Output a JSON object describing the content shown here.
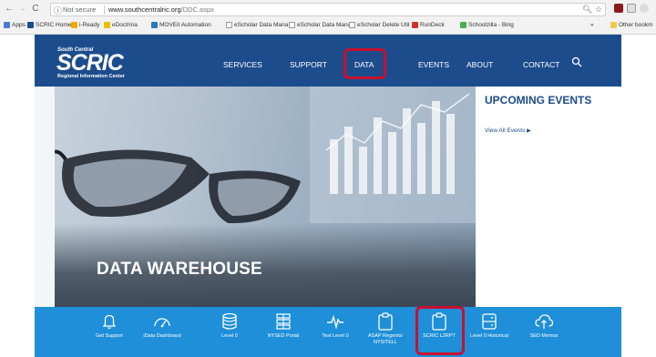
{
  "browser": {
    "url_prefix": "Not secure",
    "url_host": "www.southcentralric.org",
    "url_path": "/DDC.aspx",
    "bookmarks": [
      "Apps",
      "SCRIC Home",
      "i-Ready",
      "eDoctrina",
      "MOVEit Automation",
      "eScholar Data Mana",
      "eScholar Data Mana",
      "eScholar Delete Util",
      "RunDeck",
      "Schoolzilla - Bing",
      "»",
      "Other bookm"
    ]
  },
  "site": {
    "logo_small": "South Central",
    "logo_big": "SCRIC",
    "logo_sub": "Regional Information Center",
    "nav": [
      "SERVICES",
      "SUPPORT",
      "DATA",
      "EVENTS",
      "ABOUT",
      "CONTACT"
    ],
    "hero_title": "DATA WAREHOUSE",
    "events_title": "UPCOMING EVENTS",
    "events_link": "View All Events",
    "quick_links": [
      "Get Support",
      "iData Dashboard",
      "Level 0",
      "NYSED Portal",
      "Test Level 0",
      "ASAP Regents/ NYSITELL",
      "SCRIC L2RPT",
      "Level 0 Historical",
      "SED Memos"
    ]
  },
  "colors": {
    "header_blue": "#1c4c8c",
    "quickbar_blue": "#1e8fd8",
    "highlight_red": "#c8102e"
  }
}
